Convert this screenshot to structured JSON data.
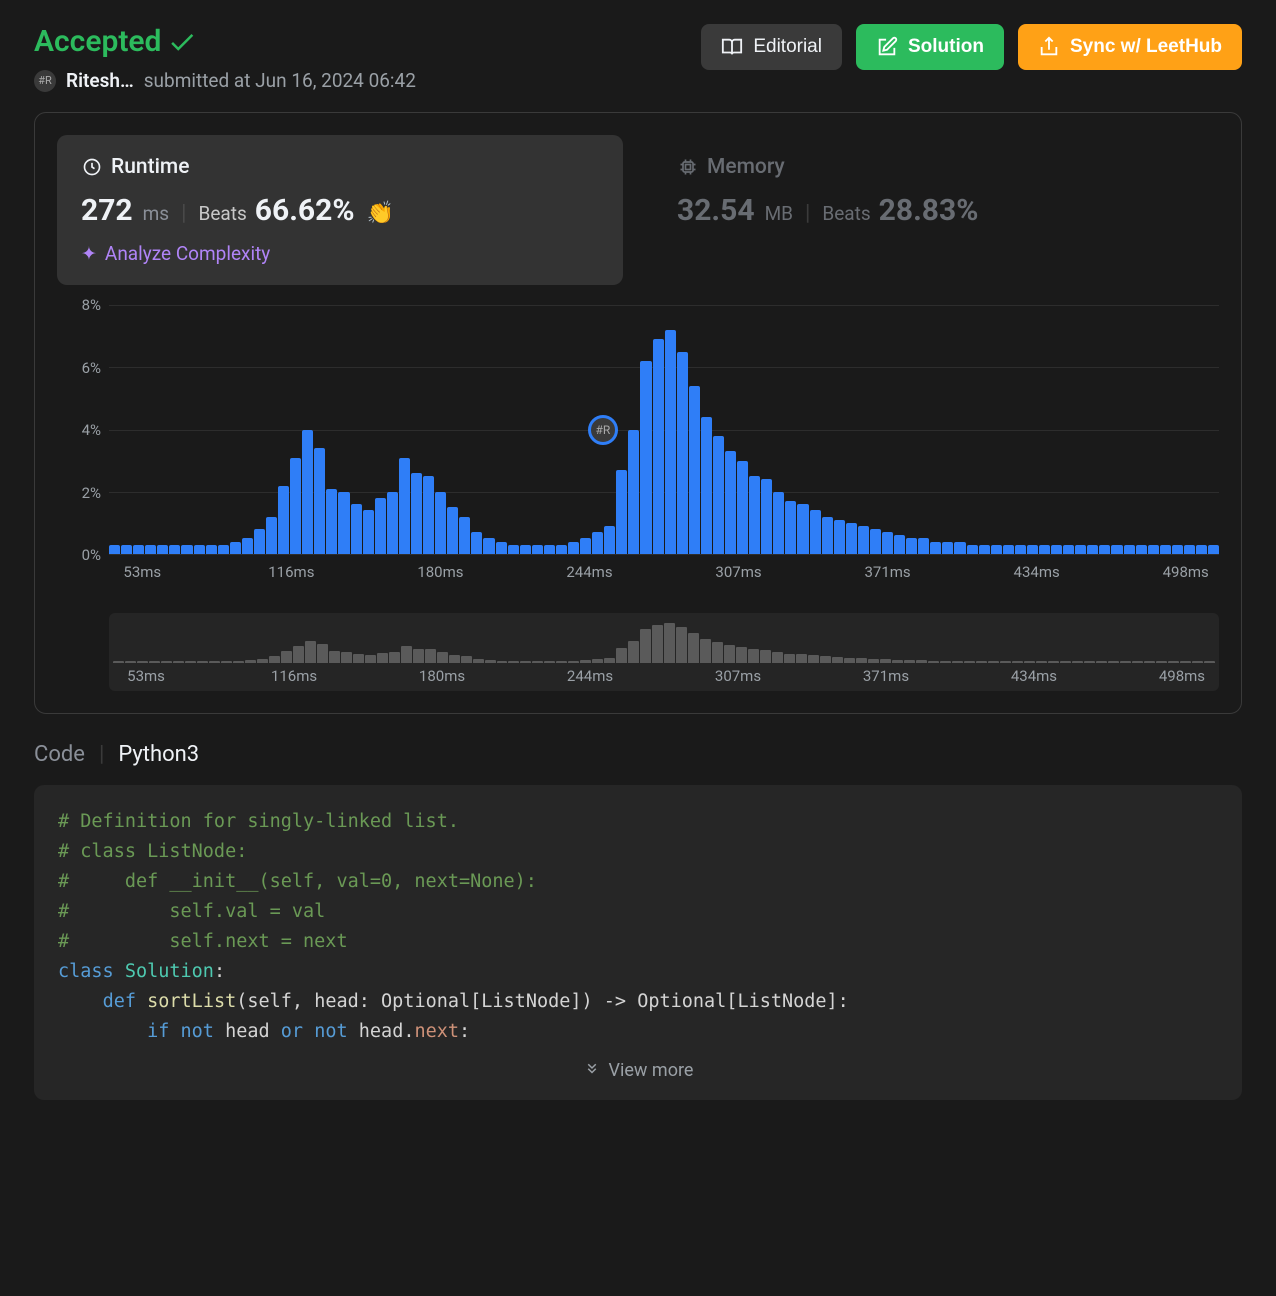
{
  "status": {
    "label": "Accepted"
  },
  "user": {
    "name": "Ritesh…",
    "submitted": "submitted at Jun 16, 2024 06:42"
  },
  "actions": {
    "editorial": "Editorial",
    "solution": "Solution",
    "sync": "Sync w/ LeetHub"
  },
  "runtime": {
    "title": "Runtime",
    "value": "272",
    "unit": "ms",
    "beats_label": "Beats",
    "beats_value": "66.62%",
    "clap": "👏",
    "analyze": "Analyze Complexity"
  },
  "memory": {
    "title": "Memory",
    "value": "32.54",
    "unit": "MB",
    "beats_label": "Beats",
    "beats_value": "28.83%"
  },
  "chart_data": {
    "type": "bar",
    "ylabel": "%",
    "ylim": [
      0,
      8
    ],
    "y_ticks": [
      0,
      2,
      4,
      6,
      8
    ],
    "x_ticks": [
      "53ms",
      "116ms",
      "180ms",
      "244ms",
      "307ms",
      "371ms",
      "434ms",
      "498ms"
    ],
    "marker_x_pct": 44.5,
    "marker_y_pct": 50,
    "values": [
      0.3,
      0.3,
      0.3,
      0.3,
      0.3,
      0.3,
      0.3,
      0.3,
      0.3,
      0.3,
      0.4,
      0.5,
      0.8,
      1.2,
      2.2,
      3.1,
      4.0,
      3.4,
      2.1,
      2.0,
      1.6,
      1.4,
      1.8,
      2.0,
      3.1,
      2.6,
      2.5,
      2.0,
      1.5,
      1.2,
      0.7,
      0.5,
      0.4,
      0.3,
      0.3,
      0.3,
      0.3,
      0.3,
      0.4,
      0.5,
      0.7,
      0.9,
      2.7,
      4.0,
      6.2,
      6.9,
      7.2,
      6.5,
      5.4,
      4.4,
      3.8,
      3.3,
      3.0,
      2.5,
      2.4,
      2.0,
      1.7,
      1.6,
      1.4,
      1.2,
      1.1,
      1.0,
      0.9,
      0.8,
      0.7,
      0.6,
      0.5,
      0.5,
      0.4,
      0.4,
      0.4,
      0.3,
      0.3,
      0.3,
      0.3,
      0.3,
      0.3,
      0.3,
      0.3,
      0.3,
      0.3,
      0.3,
      0.3,
      0.3,
      0.3,
      0.3,
      0.3,
      0.3,
      0.3,
      0.3,
      0.3,
      0.3
    ]
  },
  "code_meta": {
    "label": "Code",
    "lang": "Python3"
  },
  "code": {
    "l1": "# Definition for singly-linked list.",
    "l2": "# class ListNode:",
    "l3": "#     def __init__(self, val=0, next=None):",
    "l4": "#         self.val = val",
    "l5": "#         self.next = next",
    "kw_class": "class",
    "cls_name": "Solution",
    "kw_def": "def",
    "fn_name": "sortList",
    "sig_rest": "(self, head: Optional[ListNode]) -> Optional[ListNode]:",
    "kw_if": "if",
    "kw_not1": "not",
    "id_head1": "head",
    "kw_or": "or",
    "kw_not2": "not",
    "id_head2": "head",
    "dot": ".",
    "attr_next": "next",
    "colon": ":"
  },
  "view_more": "View more"
}
